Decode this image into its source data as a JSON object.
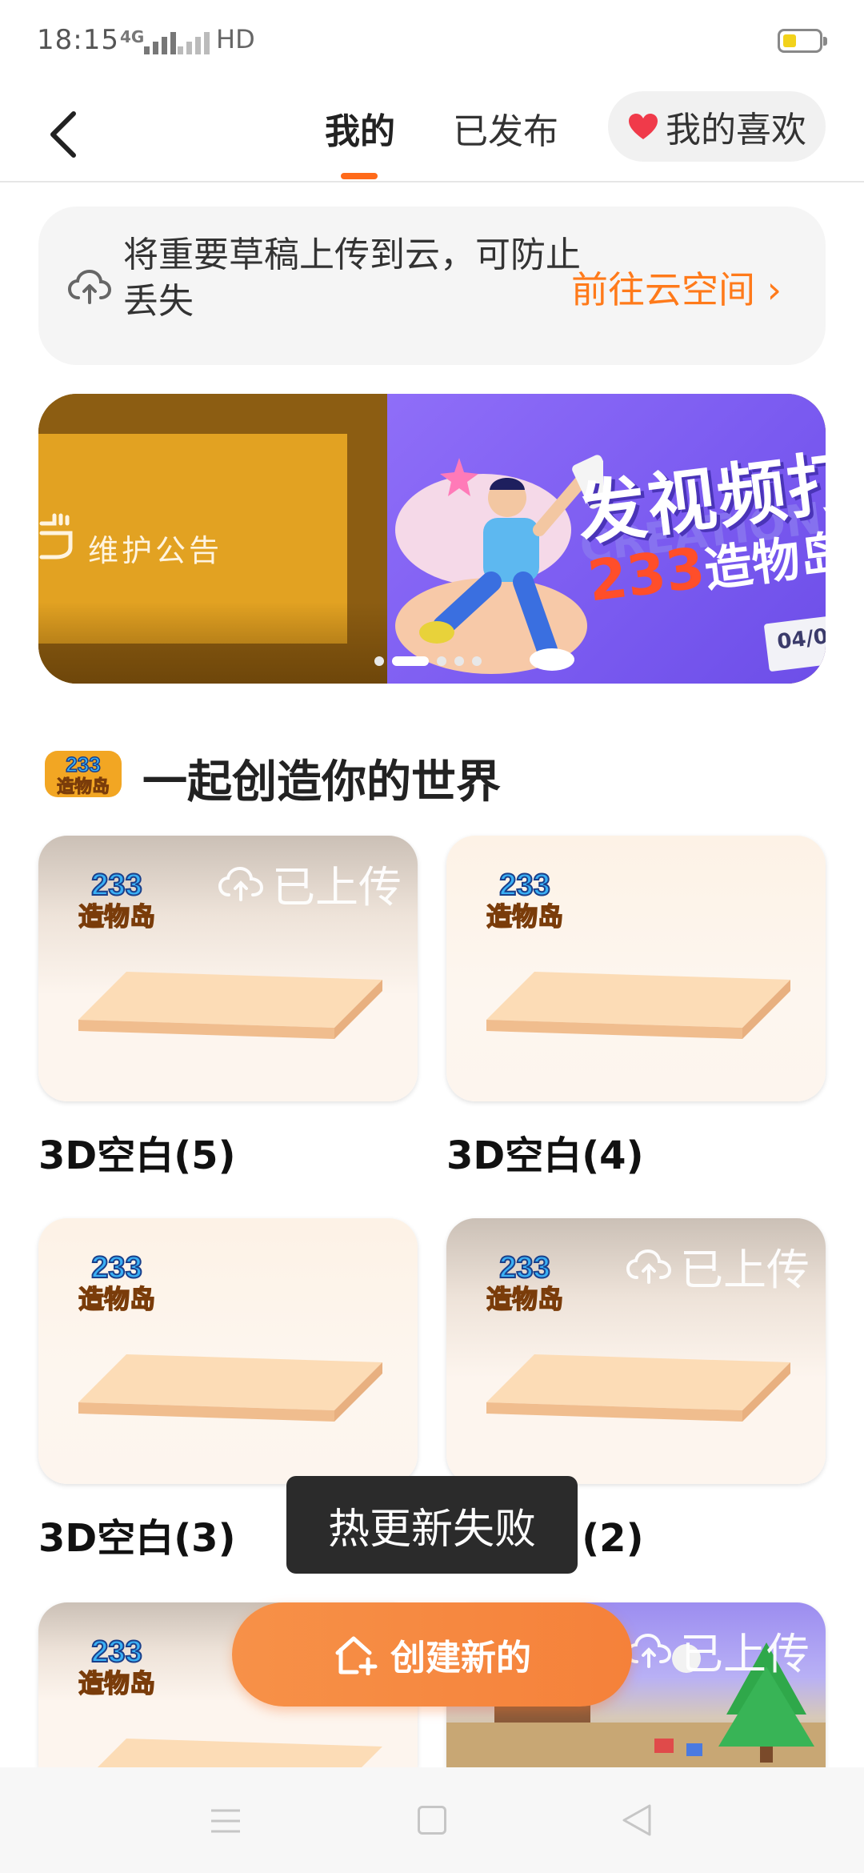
{
  "status_bar": {
    "time": "18:15",
    "network": "4G",
    "hd_label": "HD"
  },
  "header": {
    "tabs": [
      {
        "label": "我的",
        "active": true
      },
      {
        "label": "已发布",
        "active": false
      }
    ],
    "favorites_label": "我的喜欢",
    "accent_color": "#ff6a1a"
  },
  "cloud_notice": {
    "text": "将重要草稿上传到云，可防止丢失",
    "link_label": "前往云空间",
    "link_chevron": "›"
  },
  "banner": {
    "left_text": "维护公告",
    "right_title": "发视频打",
    "right_sub_prefix": "233",
    "right_sub_suffix": "造物岛",
    "right_watermark": "CREATION",
    "right_date": "04/0",
    "dots": 5,
    "active_dot": 1
  },
  "section": {
    "title": "一起创造你的世界",
    "logo_text_top": "233",
    "logo_text_bottom": "造物岛"
  },
  "projects": [
    {
      "title": "3D空白(5)",
      "uploaded": true
    },
    {
      "title": "3D空白(4)",
      "uploaded": false
    },
    {
      "title": "3D空白(3)",
      "uploaded": false
    },
    {
      "title": "3D空白(2)",
      "uploaded": true
    },
    {
      "title": "",
      "uploaded": true
    },
    {
      "title": "",
      "uploaded": true
    }
  ],
  "upload_badge_label": "已上传",
  "toast": "热更新失败",
  "create_button": "创建新的"
}
